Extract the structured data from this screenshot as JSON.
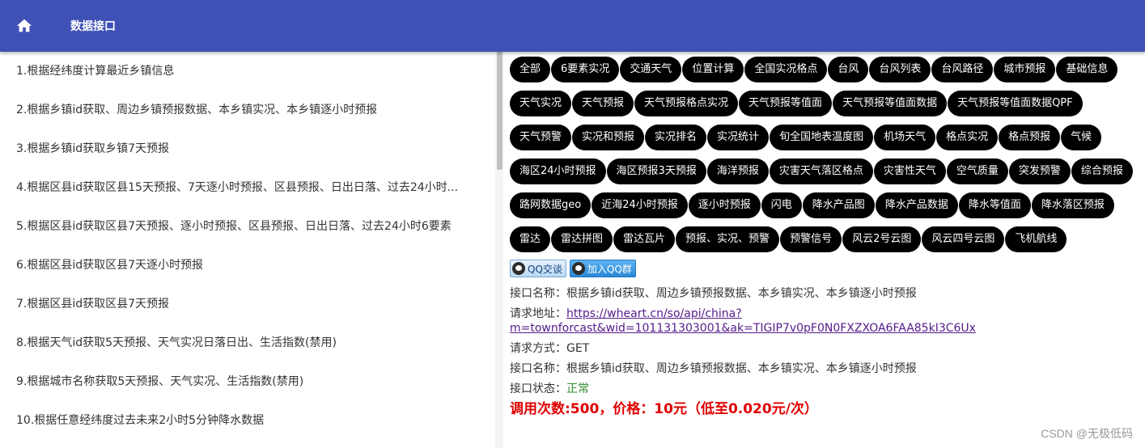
{
  "header": {
    "title": "数据接口",
    "home_icon": "home-icon",
    "bg_color": "#3f51b5"
  },
  "left_list": [
    "1.根据经纬度计算最近乡镇信息",
    "2.根据乡镇id获取、周边乡镇预报数据、本乡镇实况、本乡镇逐小时预报",
    "3.根据乡镇id获取乡镇7天预报",
    "4.根据区县id获取区县15天预报、7天逐小时预报、区县预报、日出日落、过去24小时...",
    "5.根据区县id获取区县7天预报、逐小时预报、区县预报、日出日落、过去24小时6要素",
    "6.根据区县id获取区县7天逐小时预报",
    "7.根据区县id获取区县7天预报",
    "8.根据天气id获取5天预报、天气实况日落日出、生活指数(禁用)",
    "9.根据城市名称获取5天预报、天气实况、生活指数(禁用)",
    "10.根据任意经纬度过去未来2小时5分钟降水数据"
  ],
  "tags": [
    "全部",
    "6要素实况",
    "交通天气",
    "位置计算",
    "全国实况格点",
    "台风",
    "台风列表",
    "台风路径",
    "城市预报",
    "基础信息",
    "天气实况",
    "天气预报",
    "天气预报格点实况",
    "天气预报等值面",
    "天气预报等值面数据",
    "天气预报等值面数据QPF",
    "天气预警",
    "实况和预报",
    "实况排名",
    "实况统计",
    "旬全国地表温度图",
    "机场天气",
    "格点实况",
    "格点预报",
    "气候",
    "海区24小时预报",
    "海区预报3天预报",
    "海洋预报",
    "灾害天气落区格点",
    "灾害性天气",
    "空气质量",
    "突发预警",
    "综合预报",
    "路网数据geo",
    "近海24小时预报",
    "逐小时预报",
    "闪电",
    "降水产品图",
    "降水产品数据",
    "降水等值面",
    "降水落区预报",
    "雷达",
    "雷达拼图",
    "雷达瓦片",
    "预报、实况、预警",
    "预警信号",
    "风云2号云图",
    "风云四号云图",
    "飞机航线"
  ],
  "qq": {
    "chat_label": "QQ交谈",
    "group_label": "加入QQ群"
  },
  "info": {
    "name_label": "接口名称：",
    "name_value": "根据乡镇id获取、周边乡镇预报数据、本乡镇实况、本乡镇逐小时预报",
    "url_label": "请求地址：",
    "url_line1": "https://wheart.cn/so/api/china?",
    "url_line2": "m=townforcast&wid=101131303001&ak=TIGIP7v0pF0N0FXZXOA6FAA85kI3C6Ux",
    "method_label": "请求方式：",
    "method_value": "GET",
    "name2_label": "接口名称：",
    "name2_value": "根据乡镇id获取、周边乡镇预报数据、本乡镇实况、本乡镇逐小时预报",
    "status_label": "接口状态：",
    "status_value": "正常",
    "call_line": "调用次数:500，价格：10元（低至0.020元/次）"
  },
  "watermark": "CSDN @无极低码"
}
